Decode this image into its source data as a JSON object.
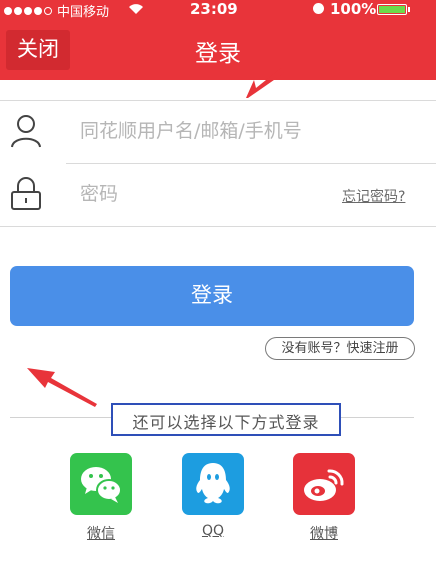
{
  "status_bar": {
    "carrier": "中国移动",
    "time": "23:09",
    "battery": "100%",
    "battery_level": 1.0,
    "signal_dots": 4,
    "signal_total": 5
  },
  "nav": {
    "close_label": "关闭",
    "title": "登录"
  },
  "form": {
    "username_placeholder": "同花顺用户名/邮箱/手机号",
    "password_placeholder": "密码",
    "forgot_label": "忘记密码?",
    "login_label": "登录",
    "register_label": "没有账号？快速注册"
  },
  "alt_login": {
    "heading": "还可以选择以下方式登录",
    "options": [
      {
        "label": "微信",
        "icon": "wechat-icon"
      },
      {
        "label": "QQ",
        "icon": "qq-icon"
      },
      {
        "label": "微博",
        "icon": "weibo-icon"
      }
    ]
  },
  "colors": {
    "brand_red": "#e8343a",
    "login_blue": "#4a8fe8",
    "wechat_green": "#34c34d",
    "qq_blue": "#1d9de0",
    "weibo_red": "#e6323a",
    "annotation_red": "#e8343a",
    "annotation_box": "#2e4fb8"
  }
}
